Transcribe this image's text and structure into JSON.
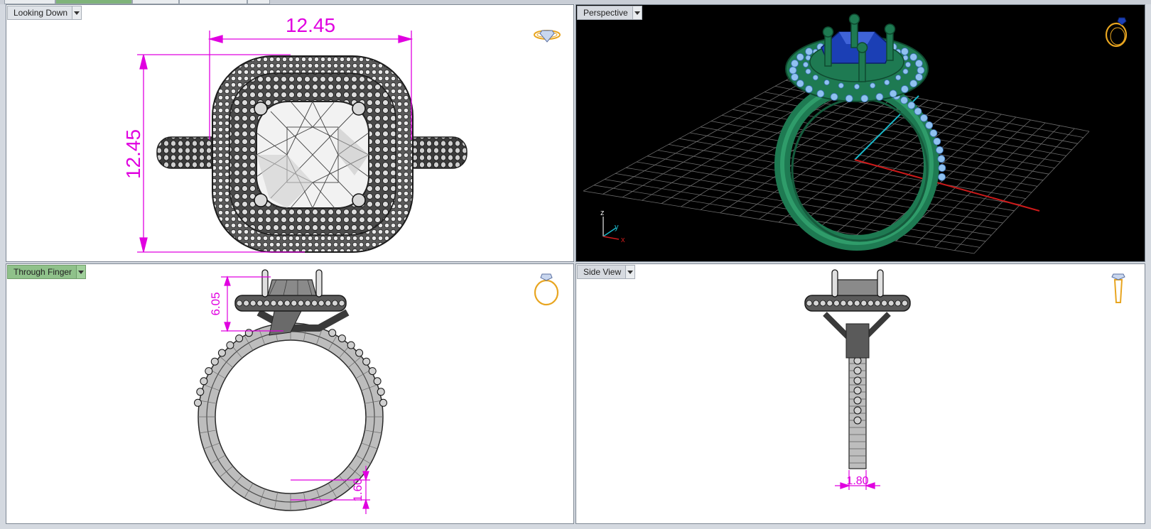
{
  "viewports": {
    "top": {
      "label": "Looking Down",
      "dim_width": "12.45",
      "dim_height": "12.45",
      "active": false
    },
    "perspective": {
      "label": "Perspective",
      "axis_z": "z",
      "axis_y": "y",
      "axis_x": "x",
      "active": false
    },
    "front": {
      "label": "Through Finger",
      "dim_height": "6.05",
      "dim_shank": "1.60",
      "active": true
    },
    "side": {
      "label": "Side View",
      "dim_shank_width": "1.80",
      "active": false
    }
  },
  "colors": {
    "dimension": "#e000e0",
    "active_label": "#8fc18a",
    "metal_green": "#1e7a52",
    "gem_blue": "#1b3fb5",
    "melee_blue": "#8fc1f0",
    "icon_gold": "#e8a520",
    "axis_red": "#cc1a1a",
    "axis_cyan": "#1ab7c9"
  },
  "icons": [
    "ring-top-icon",
    "ring-perspective-icon",
    "ring-front-icon",
    "ring-side-icon",
    "dropdown-arrow-icon"
  ]
}
